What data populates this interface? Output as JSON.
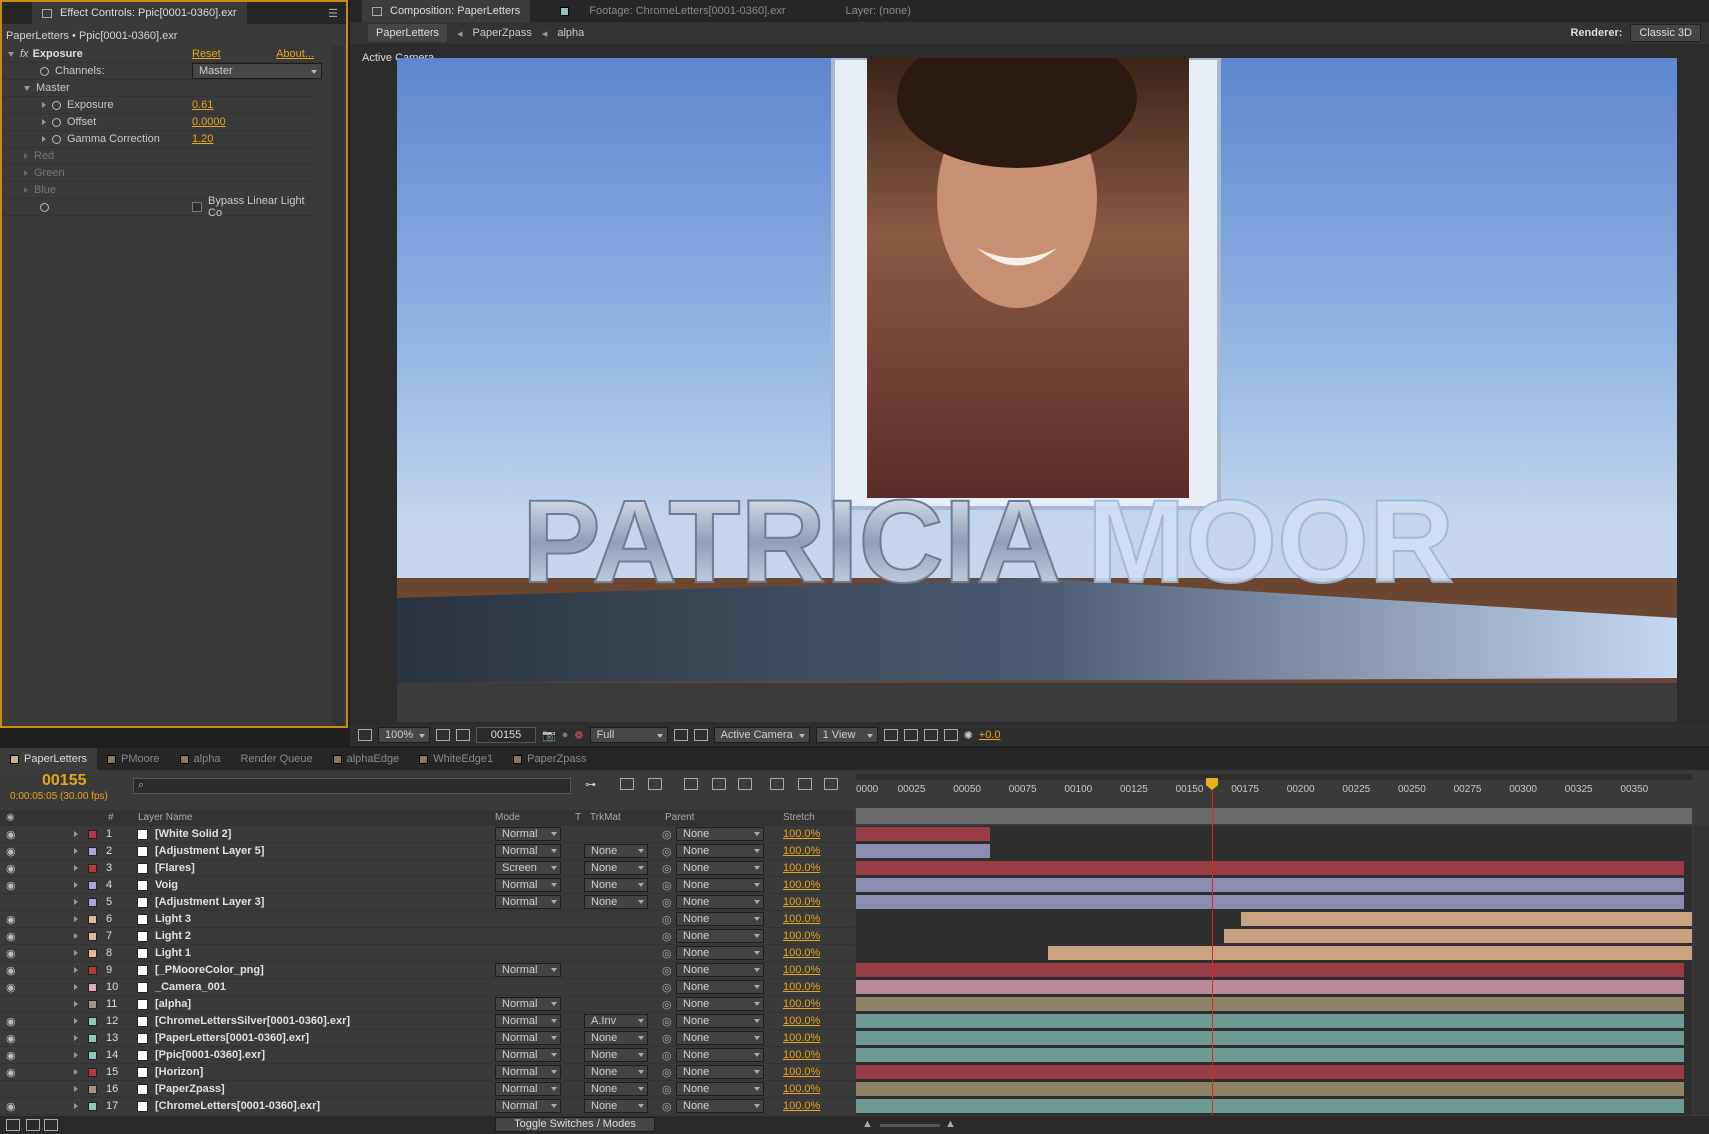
{
  "effect_panel": {
    "tab_label": "Effect Controls: Ppic[0001-0360].exr",
    "breadcrumb": "PaperLetters • Ppic[0001-0360].exr",
    "effect_name": "Exposure",
    "reset": "Reset",
    "about": "About...",
    "channels_label": "Channels:",
    "channels_value": "Master",
    "master_label": "Master",
    "exposure_label": "Exposure",
    "exposure_value": "0.61",
    "offset_label": "Offset",
    "offset_value": "0.0000",
    "gamma_label": "Gamma Correction",
    "gamma_value": "1.20",
    "red": "Red",
    "green": "Green",
    "blue": "Blue",
    "bypass_label": "Bypass Linear Light Co"
  },
  "comp_panel": {
    "tab_comp": "Composition: PaperLetters",
    "tab_footage": "Footage: ChromeLetters[0001-0360].exr",
    "tab_layer": "Layer: (none)",
    "crumbs": [
      "PaperLetters",
      "PaperZpass",
      "alpha"
    ],
    "renderer_label": "Renderer:",
    "renderer_value": "Classic 3D",
    "view_label": "Active Camera",
    "scene_text_left": "PATRICIA",
    "scene_text_right": "MOOR",
    "toolbar": {
      "zoom": "100%",
      "timecode": "00155",
      "resolution": "Full",
      "camera": "Active Camera",
      "views": "1 View",
      "exposure": "+0.0"
    }
  },
  "timeline": {
    "tabs": [
      "PaperLetters",
      "PMoore",
      "alpha",
      "Render Queue",
      "alphaEdge",
      "WhiteEdge1",
      "PaperZpass"
    ],
    "tab_colors": [
      "#c8b089",
      "#8a7560",
      "#8a7560",
      "",
      "#8a7560",
      "#8a7560",
      "#8a7560"
    ],
    "timecode": "00155",
    "timecode_sub": "0:00:05:05 (30.00 fps)",
    "headers": {
      "num": "#",
      "name": "Layer Name",
      "mode": "Mode",
      "t": "T",
      "trkmat": "TrkMat",
      "parent": "Parent",
      "stretch": "Stretch"
    },
    "ruler": [
      "0000",
      "00025",
      "00050",
      "00075",
      "00100",
      "00125",
      "00150",
      "00175",
      "00200",
      "00225",
      "00250",
      "00275",
      "00300",
      "00325",
      "00350"
    ],
    "toggle_label": "Toggle Switches / Modes",
    "layers": [
      {
        "num": "1",
        "name": "[White Solid 2]",
        "label": "#b53b3b",
        "mode": "Normal",
        "trk": "",
        "parent": "None",
        "stretch": "100.0%",
        "eye": true,
        "bar": [
          0,
          0.16
        ],
        "bar_color": "#9a3c46"
      },
      {
        "num": "2",
        "name": "[Adjustment Layer 5]",
        "label": "#a8a8d8",
        "mode": "Normal",
        "trk": "None",
        "parent": "None",
        "stretch": "100.0%",
        "eye": true,
        "bar": [
          0,
          0.16
        ],
        "bar_color": "#8b8cb2"
      },
      {
        "num": "3",
        "name": "[Flares]",
        "label": "#b53b3b",
        "mode": "Screen",
        "trk": "None",
        "parent": "None",
        "stretch": "100.0%",
        "eye": true,
        "bar": [
          0,
          0.99
        ],
        "bar_color": "#9a3c46"
      },
      {
        "num": "4",
        "name": "Voig",
        "label": "#a8a8d8",
        "mode": "Normal",
        "trk": "None",
        "parent": "None",
        "stretch": "100.0%",
        "eye": true,
        "bar": [
          0,
          0.99
        ],
        "bar_color": "#8b8cb2"
      },
      {
        "num": "5",
        "name": "[Adjustment Layer 3]",
        "label": "#a8a8d8",
        "mode": "Normal",
        "trk": "None",
        "parent": "None",
        "stretch": "100.0%",
        "eye": false,
        "bar": [
          0,
          0.99
        ],
        "bar_color": "#8b8cb2"
      },
      {
        "num": "6",
        "name": "Light 3",
        "label": "#e6b98c",
        "mode": "",
        "trk": "",
        "parent": "None",
        "stretch": "100.0%",
        "eye": true,
        "bar": [
          0.46,
          1.0
        ],
        "bar_color": "#c9a27f"
      },
      {
        "num": "7",
        "name": "Light 2",
        "label": "#e6b98c",
        "mode": "",
        "trk": "",
        "parent": "None",
        "stretch": "100.0%",
        "eye": true,
        "bar": [
          0.44,
          1.0
        ],
        "bar_color": "#c9a27f"
      },
      {
        "num": "8",
        "name": "Light 1",
        "label": "#e6b98c",
        "mode": "",
        "trk": "",
        "parent": "None",
        "stretch": "100.0%",
        "eye": true,
        "bar": [
          0.23,
          1.0
        ],
        "bar_color": "#c9a27f"
      },
      {
        "num": "9",
        "name": "[_PMooreColor_png]",
        "label": "#b53b3b",
        "mode": "Normal",
        "trk": "",
        "parent": "None",
        "stretch": "100.0%",
        "eye": true,
        "bar": [
          0,
          0.99
        ],
        "bar_color": "#9a3c46"
      },
      {
        "num": "10",
        "name": "_Camera_001",
        "label": "#e4a8b8",
        "mode": "",
        "trk": "",
        "parent": "None",
        "stretch": "100.0%",
        "eye": true,
        "bar": [
          0,
          0.99
        ],
        "bar_color": "#b88a9a"
      },
      {
        "num": "11",
        "name": "[alpha]",
        "label": "#a8957a",
        "mode": "Normal",
        "trk": "",
        "parent": "None",
        "stretch": "100.0%",
        "eye": false,
        "bar": [
          0,
          0.99
        ],
        "bar_color": "#8e8268"
      },
      {
        "num": "12",
        "name": "[ChromeLettersSilver[0001-0360].exr]",
        "label": "#8fc6c2",
        "mode": "Normal",
        "trk": "A.Inv",
        "parent": "None",
        "stretch": "100.0%",
        "eye": true,
        "bar": [
          0,
          0.99
        ],
        "bar_color": "#6e9a94"
      },
      {
        "num": "13",
        "name": "[PaperLetters[0001-0360].exr]",
        "label": "#8fc6c2",
        "mode": "Normal",
        "trk": "None",
        "parent": "None",
        "stretch": "100.0%",
        "eye": true,
        "bar": [
          0,
          0.99
        ],
        "bar_color": "#6e9a94"
      },
      {
        "num": "14",
        "name": "[Ppic[0001-0360].exr]",
        "label": "#8fc6c2",
        "mode": "Normal",
        "trk": "None",
        "parent": "None",
        "stretch": "100.0%",
        "eye": true,
        "bar": [
          0,
          0.99
        ],
        "bar_color": "#6e9a94"
      },
      {
        "num": "15",
        "name": "[Horizon]",
        "label": "#b53b3b",
        "mode": "Normal",
        "trk": "None",
        "parent": "None",
        "stretch": "100.0%",
        "eye": true,
        "bar": [
          0,
          0.99
        ],
        "bar_color": "#9a3c46"
      },
      {
        "num": "16",
        "name": "[PaperZpass]",
        "label": "#a8957a",
        "mode": "Normal",
        "trk": "None",
        "parent": "None",
        "stretch": "100.0%",
        "eye": false,
        "bar": [
          0,
          0.99
        ],
        "bar_color": "#8e8268"
      },
      {
        "num": "17",
        "name": "[ChromeLetters[0001-0360].exr]",
        "label": "#8fc6c2",
        "mode": "Normal",
        "trk": "None",
        "parent": "None",
        "stretch": "100.0%",
        "eye": true,
        "bar": [
          0,
          0.99
        ],
        "bar_color": "#6e9a94"
      }
    ]
  }
}
